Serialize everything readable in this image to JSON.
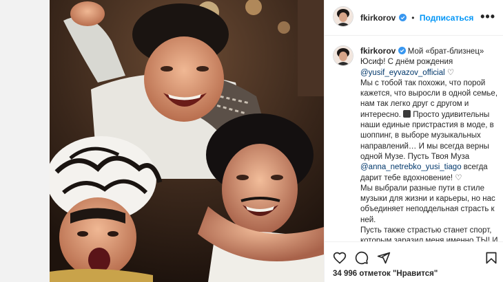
{
  "post": {
    "username": "fkirkorov",
    "follow_label": "Подписаться",
    "separator": "•",
    "more_label": "•••"
  },
  "caption": {
    "username": "fkirkorov",
    "intro": "Мой «брат-близнец» Юсиф! С днём рождения",
    "mention1": "@yusif_eyvazov_official",
    "para1_a": "Мы с тобой так похожи, что порой кажется, что выросли в одной семье, нам так легко друг с другом и интересно.",
    "para1_b": "Просто удивительны наши единые пристрастия в моде, в шоппинг, в выборе музыкальных направлений… И мы всегда верны одной Музе. Пусть Твоя Муза",
    "mention2": "@anna_netrebko_yusi_tiago",
    "para1_c": "всегда дарит тебе вдохновение!",
    "para2": "Мы выбрали разные пути в стиле музыки для жизни и карьеры, но нас объединяет неподдельная страсть к ней.",
    "para3": "Пусть также страстью станет спорт, которым заразил меня именно ТЫ! И какие успехи мы делаем с тобой и в этом направлении. Результат на"
  },
  "actions": {
    "like_icon": "heart-icon",
    "comment_icon": "comment-icon",
    "share_icon": "share-icon",
    "save_icon": "bookmark-icon"
  },
  "likes": {
    "count": "34 996",
    "middle": "отметок \"Нравится\"",
    "prefix": "отметок",
    "suffix": "\"Нравится\""
  },
  "colors": {
    "accent": "#0095f6",
    "link": "#00376b",
    "verified": "#3897f0"
  }
}
